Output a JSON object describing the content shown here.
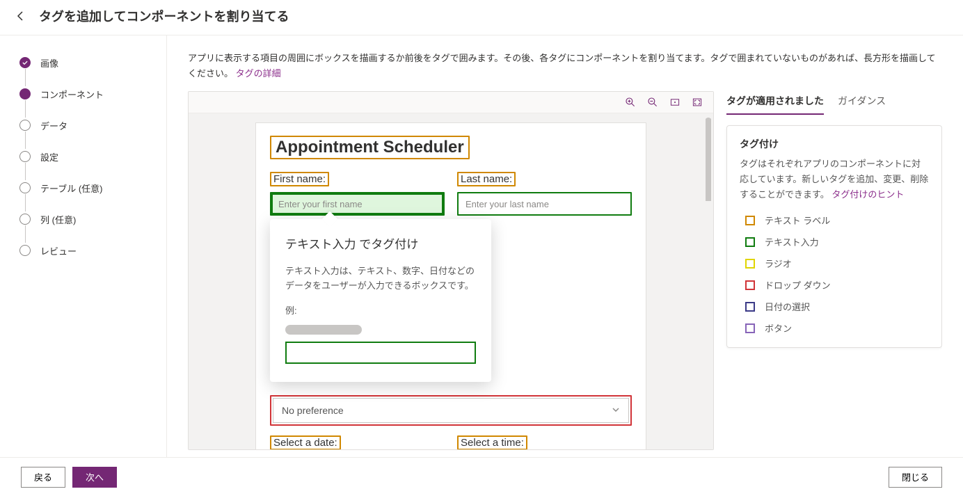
{
  "header": {
    "title": "タグを追加してコンポーネントを割り当てる"
  },
  "stepper": {
    "items": [
      {
        "label": "画像",
        "state": "done"
      },
      {
        "label": "コンポーネント",
        "state": "current"
      },
      {
        "label": "データ",
        "state": "pending"
      },
      {
        "label": "設定",
        "state": "pending"
      },
      {
        "label": "テーブル (任意)",
        "state": "pending"
      },
      {
        "label": "列 (任意)",
        "state": "pending"
      },
      {
        "label": "レビュー",
        "state": "pending"
      }
    ]
  },
  "instruction": {
    "text": "アプリに表示する項目の周囲にボックスを描画するか前後をタグで囲みます。その後、各タグにコンポーネントを割り当てます。タグで囲まれていないものがあれば、長方形を描画してください。",
    "link": "タグの詳細"
  },
  "app": {
    "title": "Appointment Scheduler",
    "firstNameLabel": "First name:",
    "firstNamePlaceholder": "Enter your first name",
    "lastNameLabel": "Last name:",
    "lastNamePlaceholder": "Enter your last name",
    "dropdownValue": "No preference",
    "selectDateLabel": "Select a date:",
    "selectTimeLabel": "Select a time:"
  },
  "popover": {
    "title": "テキスト入力 でタグ付け",
    "desc": "テキスト入力は、テキスト、数字、日付などのデータをユーザーが入力できるボックスです。",
    "exampleLabel": "例:"
  },
  "rightPanel": {
    "tabs": {
      "applied": "タグが適用されました",
      "guidance": "ガイダンス"
    },
    "card": {
      "title": "タグ付け",
      "desc": "タグはそれぞれアプリのコンポーネントに対応しています。新しいタグを追加、変更、削除することができます。",
      "link": "タグ付けのヒント"
    },
    "legend": {
      "textLabel": "テキスト ラベル",
      "textInput": "テキスト入力",
      "radio": "ラジオ",
      "dropdown": "ドロップ ダウン",
      "datePicker": "日付の選択",
      "button": "ボタン"
    }
  },
  "footer": {
    "back": "戻る",
    "next": "次へ",
    "close": "閉じる"
  }
}
